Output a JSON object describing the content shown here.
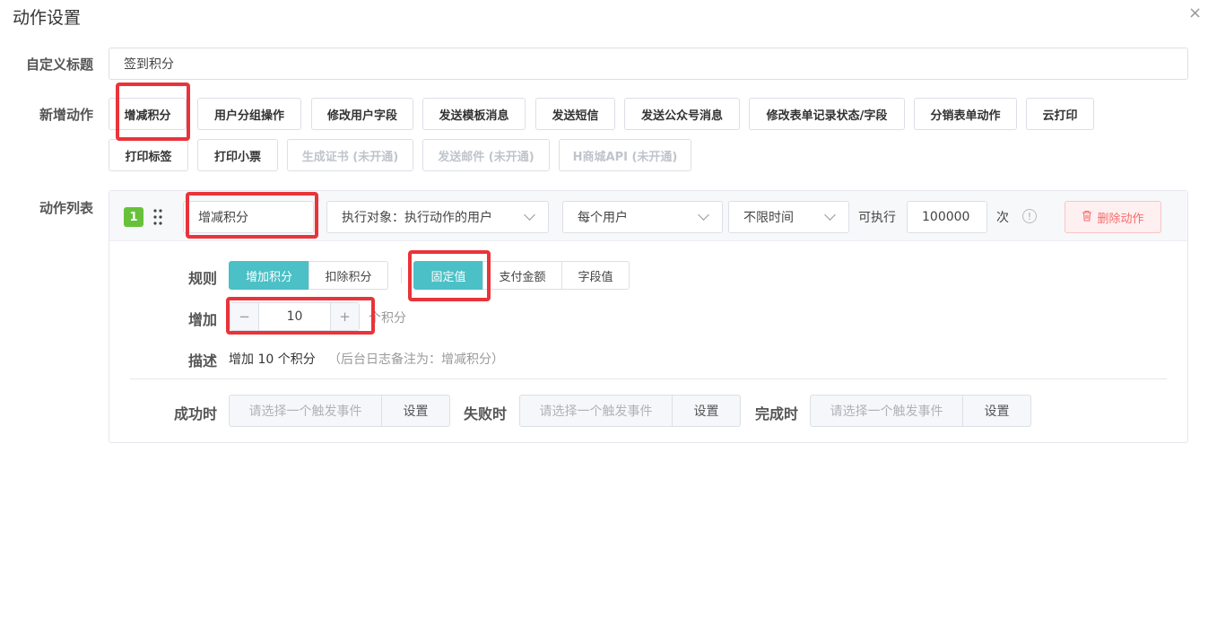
{
  "dialog": {
    "title": "动作设置",
    "close": "×"
  },
  "form": {
    "custom_title_label": "自定义标题",
    "custom_title_value": "签到积分",
    "new_action_label": "新增动作",
    "action_list_label": "动作列表"
  },
  "action_buttons": {
    "row1": [
      "增减积分",
      "用户分组操作",
      "修改用户字段",
      "发送模板消息",
      "发送短信",
      "发送公众号消息",
      "修改表单记录状态/字段",
      "分销表单动作",
      "云打印"
    ],
    "row2": [
      "打印标签",
      "打印小票",
      "生成证书 (未开通)",
      "发送邮件 (未开通)",
      "H商城API (未开通)"
    ]
  },
  "action_item": {
    "index": "1",
    "name": "增减积分",
    "target": "执行对象：执行动作的用户",
    "scope": "每个用户",
    "time": "不限时间",
    "exec_prefix": "可执行",
    "exec_count": "100000",
    "exec_suffix": "次",
    "delete_label": "删除动作",
    "rule_label": "规则",
    "rule_options": [
      "增加积分",
      "扣除积分"
    ],
    "value_options": [
      "固定值",
      "支付金额",
      "字段值"
    ],
    "increase_label": "增加",
    "increase_value": "10",
    "unit": "个积分",
    "desc_label": "描述",
    "desc_main": "增加 10 个积分",
    "desc_note": "（后台日志备注为：增减积分）",
    "success_label": "成功时",
    "fail_label": "失败时",
    "complete_label": "完成时",
    "trigger_placeholder": "请选择一个触发事件",
    "set_label": "设置"
  },
  "colors": {
    "accent": "#4bc0c6",
    "badge": "#67c23a",
    "danger": "#f56c6c",
    "highlight": "#e8343a"
  }
}
